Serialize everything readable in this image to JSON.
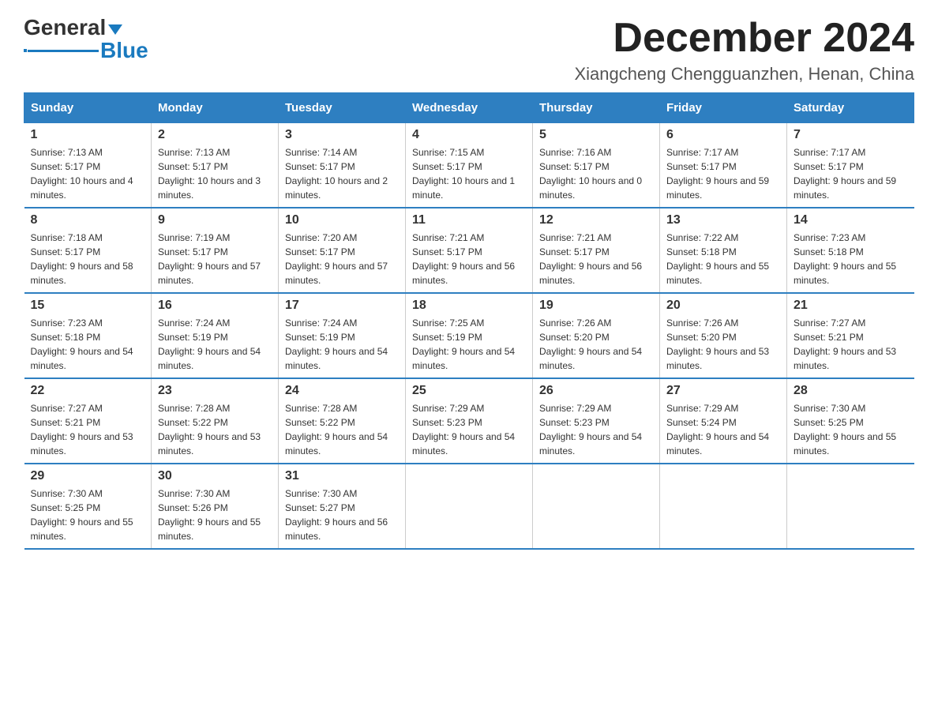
{
  "logo": {
    "text_general": "General",
    "text_blue": "Blue"
  },
  "title": "December 2024",
  "subtitle": "Xiangcheng Chengguanzhen, Henan, China",
  "weekdays": [
    "Sunday",
    "Monday",
    "Tuesday",
    "Wednesday",
    "Thursday",
    "Friday",
    "Saturday"
  ],
  "weeks": [
    [
      {
        "day": "1",
        "sunrise": "7:13 AM",
        "sunset": "5:17 PM",
        "daylight": "10 hours and 4 minutes."
      },
      {
        "day": "2",
        "sunrise": "7:13 AM",
        "sunset": "5:17 PM",
        "daylight": "10 hours and 3 minutes."
      },
      {
        "day": "3",
        "sunrise": "7:14 AM",
        "sunset": "5:17 PM",
        "daylight": "10 hours and 2 minutes."
      },
      {
        "day": "4",
        "sunrise": "7:15 AM",
        "sunset": "5:17 PM",
        "daylight": "10 hours and 1 minute."
      },
      {
        "day": "5",
        "sunrise": "7:16 AM",
        "sunset": "5:17 PM",
        "daylight": "10 hours and 0 minutes."
      },
      {
        "day": "6",
        "sunrise": "7:17 AM",
        "sunset": "5:17 PM",
        "daylight": "9 hours and 59 minutes."
      },
      {
        "day": "7",
        "sunrise": "7:17 AM",
        "sunset": "5:17 PM",
        "daylight": "9 hours and 59 minutes."
      }
    ],
    [
      {
        "day": "8",
        "sunrise": "7:18 AM",
        "sunset": "5:17 PM",
        "daylight": "9 hours and 58 minutes."
      },
      {
        "day": "9",
        "sunrise": "7:19 AM",
        "sunset": "5:17 PM",
        "daylight": "9 hours and 57 minutes."
      },
      {
        "day": "10",
        "sunrise": "7:20 AM",
        "sunset": "5:17 PM",
        "daylight": "9 hours and 57 minutes."
      },
      {
        "day": "11",
        "sunrise": "7:21 AM",
        "sunset": "5:17 PM",
        "daylight": "9 hours and 56 minutes."
      },
      {
        "day": "12",
        "sunrise": "7:21 AM",
        "sunset": "5:17 PM",
        "daylight": "9 hours and 56 minutes."
      },
      {
        "day": "13",
        "sunrise": "7:22 AM",
        "sunset": "5:18 PM",
        "daylight": "9 hours and 55 minutes."
      },
      {
        "day": "14",
        "sunrise": "7:23 AM",
        "sunset": "5:18 PM",
        "daylight": "9 hours and 55 minutes."
      }
    ],
    [
      {
        "day": "15",
        "sunrise": "7:23 AM",
        "sunset": "5:18 PM",
        "daylight": "9 hours and 54 minutes."
      },
      {
        "day": "16",
        "sunrise": "7:24 AM",
        "sunset": "5:19 PM",
        "daylight": "9 hours and 54 minutes."
      },
      {
        "day": "17",
        "sunrise": "7:24 AM",
        "sunset": "5:19 PM",
        "daylight": "9 hours and 54 minutes."
      },
      {
        "day": "18",
        "sunrise": "7:25 AM",
        "sunset": "5:19 PM",
        "daylight": "9 hours and 54 minutes."
      },
      {
        "day": "19",
        "sunrise": "7:26 AM",
        "sunset": "5:20 PM",
        "daylight": "9 hours and 54 minutes."
      },
      {
        "day": "20",
        "sunrise": "7:26 AM",
        "sunset": "5:20 PM",
        "daylight": "9 hours and 53 minutes."
      },
      {
        "day": "21",
        "sunrise": "7:27 AM",
        "sunset": "5:21 PM",
        "daylight": "9 hours and 53 minutes."
      }
    ],
    [
      {
        "day": "22",
        "sunrise": "7:27 AM",
        "sunset": "5:21 PM",
        "daylight": "9 hours and 53 minutes."
      },
      {
        "day": "23",
        "sunrise": "7:28 AM",
        "sunset": "5:22 PM",
        "daylight": "9 hours and 53 minutes."
      },
      {
        "day": "24",
        "sunrise": "7:28 AM",
        "sunset": "5:22 PM",
        "daylight": "9 hours and 54 minutes."
      },
      {
        "day": "25",
        "sunrise": "7:29 AM",
        "sunset": "5:23 PM",
        "daylight": "9 hours and 54 minutes."
      },
      {
        "day": "26",
        "sunrise": "7:29 AM",
        "sunset": "5:23 PM",
        "daylight": "9 hours and 54 minutes."
      },
      {
        "day": "27",
        "sunrise": "7:29 AM",
        "sunset": "5:24 PM",
        "daylight": "9 hours and 54 minutes."
      },
      {
        "day": "28",
        "sunrise": "7:30 AM",
        "sunset": "5:25 PM",
        "daylight": "9 hours and 55 minutes."
      }
    ],
    [
      {
        "day": "29",
        "sunrise": "7:30 AM",
        "sunset": "5:25 PM",
        "daylight": "9 hours and 55 minutes."
      },
      {
        "day": "30",
        "sunrise": "7:30 AM",
        "sunset": "5:26 PM",
        "daylight": "9 hours and 55 minutes."
      },
      {
        "day": "31",
        "sunrise": "7:30 AM",
        "sunset": "5:27 PM",
        "daylight": "9 hours and 56 minutes."
      },
      null,
      null,
      null,
      null
    ]
  ]
}
